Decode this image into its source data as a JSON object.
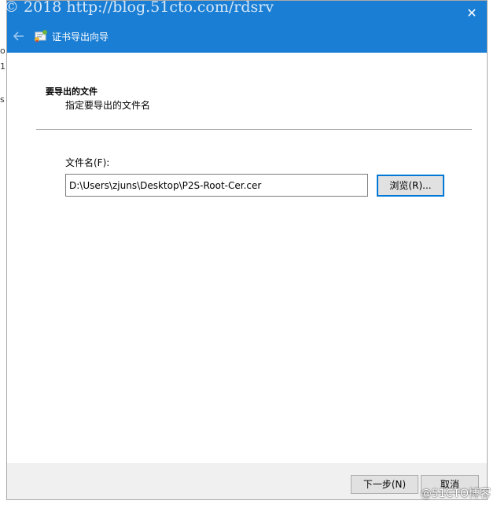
{
  "watermark": "© 2018 http://blog.51cto.com/rdsrv",
  "left_fragments": [
    "o",
    "1(",
    "s"
  ],
  "titlebar": {
    "close_glyph": "✕",
    "wizard_title": "证书导出向导"
  },
  "header": {
    "title": "要导出的文件",
    "subtitle": "指定要导出的文件名"
  },
  "form": {
    "filename_label": "文件名(F):",
    "filename_value": "D:\\Users\\zjuns\\Desktop\\P2S-Root-Cer.cer",
    "browse_label": "浏览(R)..."
  },
  "footer": {
    "next_label": "下一步(N)",
    "cancel_label": "取消"
  },
  "site_mark": "@51CTO博客",
  "icons": {
    "back": "back-arrow-icon",
    "wizard": "certificate-icon",
    "close": "close-icon"
  },
  "colors": {
    "titlebar": "#1a7ed4",
    "focus_border": "#0078d7"
  }
}
